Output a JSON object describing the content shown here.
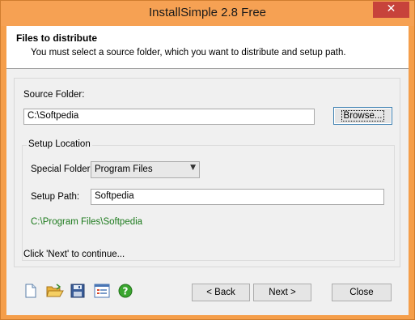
{
  "window": {
    "title": "InstallSimple 2.8 Free",
    "close_glyph": "✕"
  },
  "header": {
    "title": "Files to distribute",
    "subtitle": "You must select a source folder, which you want to distribute and setup path."
  },
  "source": {
    "label": "Source Folder:",
    "value": "C:\\Softpedia",
    "browse_label": "Browse..."
  },
  "setup_location": {
    "group_label": "Setup Location",
    "special_folder_label": "Special Folder:",
    "special_folder_value": "Program Files",
    "setup_path_label": "Setup Path:",
    "setup_path_value": "Softpedia",
    "resulting_path": "C:\\Program Files\\Softpedia"
  },
  "hint": "Click 'Next' to continue...",
  "footer": {
    "icons": [
      "new-document-icon",
      "open-folder-icon",
      "save-disk-icon",
      "settings-list-icon",
      "help-icon"
    ],
    "back_label": "< Back",
    "next_label": "Next >",
    "close_label": "Close"
  },
  "colors": {
    "titlebar": "#f6a153",
    "close_button": "#c7433b",
    "path_text": "#1c7a1c",
    "help_green": "#3aa62f"
  }
}
